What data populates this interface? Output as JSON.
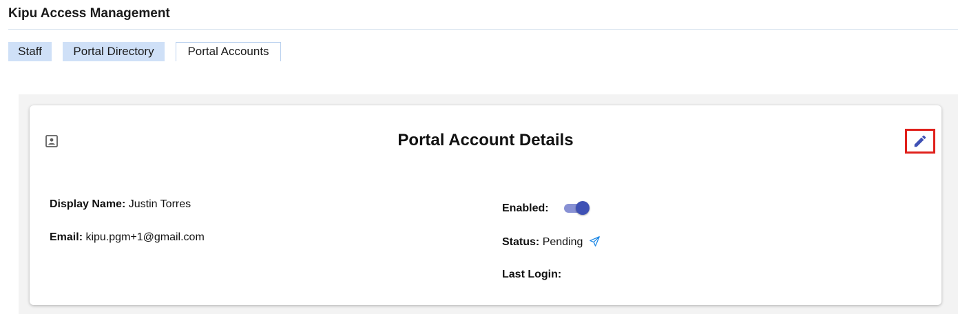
{
  "app": {
    "title": "Kipu Access Management"
  },
  "tabs": [
    {
      "label": "Staff",
      "active": false
    },
    {
      "label": "Portal Directory",
      "active": false
    },
    {
      "label": "Portal Accounts",
      "active": true
    }
  ],
  "card": {
    "title": "Portal Account Details",
    "header_icon": "account-box-icon",
    "edit_icon": "pencil-icon",
    "fields": {
      "display_name": {
        "label": "Display Name:",
        "value": "Justin Torres"
      },
      "email": {
        "label": "Email:",
        "value": "kipu.pgm+1@gmail.com"
      },
      "enabled": {
        "label": "Enabled:",
        "value": true
      },
      "status": {
        "label": "Status:",
        "value": "Pending",
        "icon": "send-icon"
      },
      "last_login": {
        "label": "Last Login:",
        "value": ""
      }
    }
  },
  "colors": {
    "tab_inactive_bg": "#cfe0f7",
    "accent": "#3f51b5",
    "toggle_track": "#8891d4",
    "highlight_border": "#e0201b",
    "send_icon": "#1e88e5"
  }
}
